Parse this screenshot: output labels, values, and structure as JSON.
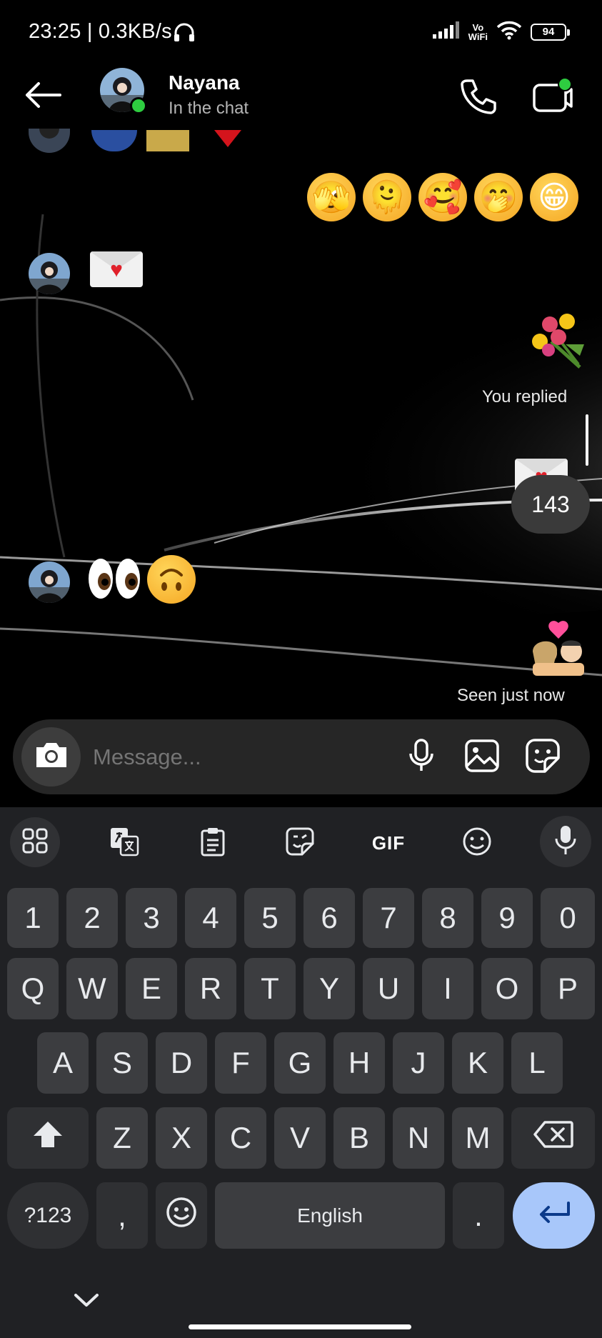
{
  "status_bar": {
    "time_speed": "23:25 | 0.3KB/s",
    "vowifi_top": "Vo",
    "vowifi_bottom": "WiFi",
    "battery": "94"
  },
  "header": {
    "contact_name": "Nayana",
    "contact_status": "In the chat"
  },
  "messages": {
    "sent_emojis": [
      "🫣",
      "🫠",
      "🥰",
      "🤭",
      "😁"
    ],
    "received_envelope": "💌",
    "sent_flowers": "💐",
    "reply_label": "You replied",
    "sent_text": "143",
    "received_emojis": [
      "👀",
      "🙃"
    ],
    "sent_kiss": "💏",
    "seen_label": "Seen just now"
  },
  "composer": {
    "placeholder": "Message..."
  },
  "keyboard": {
    "toolbar": [
      "apps-grid",
      "translate",
      "clipboard",
      "sticker",
      "GIF",
      "emoji",
      "voice"
    ],
    "gif_label": "GIF",
    "row_numbers": [
      "1",
      "2",
      "3",
      "4",
      "5",
      "6",
      "7",
      "8",
      "9",
      "0"
    ],
    "row_q": [
      "Q",
      "W",
      "E",
      "R",
      "T",
      "Y",
      "U",
      "I",
      "O",
      "P"
    ],
    "row_a": [
      "A",
      "S",
      "D",
      "F",
      "G",
      "H",
      "J",
      "K",
      "L"
    ],
    "row_z": [
      "Z",
      "X",
      "C",
      "V",
      "B",
      "N",
      "M"
    ],
    "symbols_key": "?123",
    "comma_key": ",",
    "space_key": "English",
    "period_key": "."
  },
  "colors": {
    "online": "#2ecc40",
    "enter_key": "#a8c7fa",
    "key": "#3c3d40",
    "keyboard_bg": "#202124"
  }
}
